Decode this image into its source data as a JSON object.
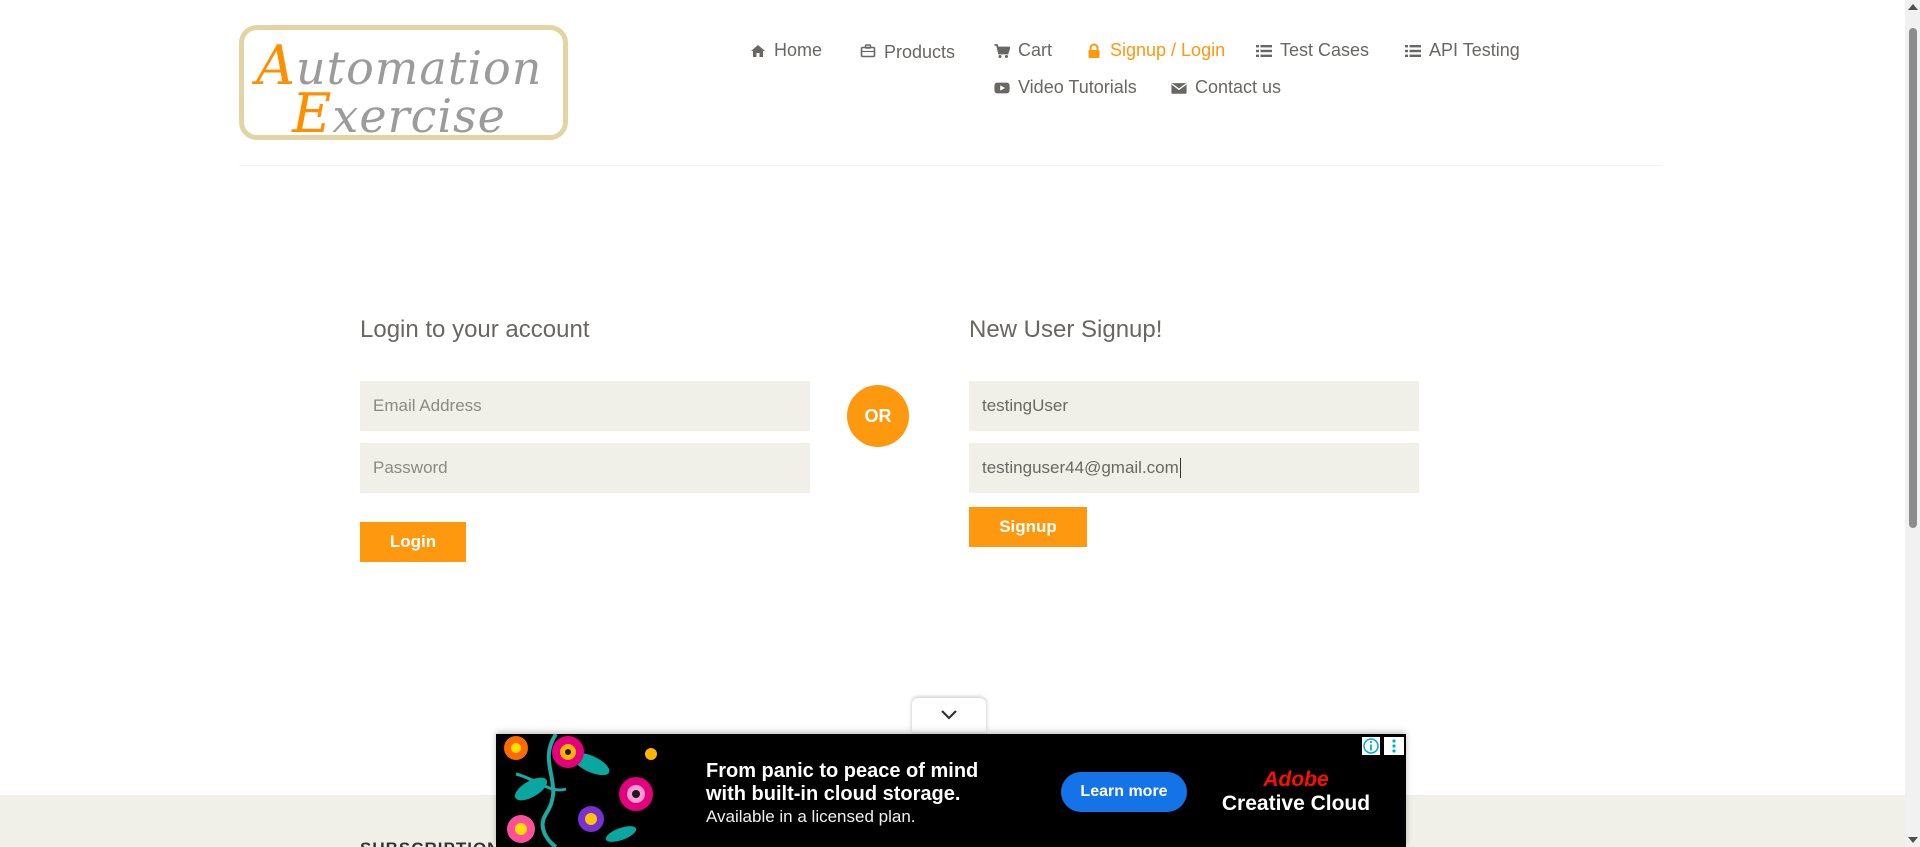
{
  "logo": {
    "line1_cap": "A",
    "line1_rest": "utomation",
    "line2_cap": "E",
    "line2_rest": "xercise"
  },
  "nav": {
    "items": [
      {
        "label": "Home",
        "icon": "home-icon"
      },
      {
        "label": "Products",
        "icon": "briefcase-icon"
      },
      {
        "label": "Cart",
        "icon": "cart-icon"
      },
      {
        "label": "Signup / Login",
        "icon": "lock-icon",
        "active": true
      },
      {
        "label": "Test Cases",
        "icon": "list-icon"
      },
      {
        "label": "API Testing",
        "icon": "list-icon"
      },
      {
        "label": "Video Tutorials",
        "icon": "youtube-icon"
      },
      {
        "label": "Contact us",
        "icon": "envelope-icon"
      }
    ]
  },
  "login": {
    "title": "Login to your account",
    "email_placeholder": "Email Address",
    "password_placeholder": "Password",
    "button": "Login"
  },
  "divider": {
    "or": "OR"
  },
  "signup": {
    "title": "New User Signup!",
    "name_value": "testingUser",
    "email_value": "testinguser44@gmail.com",
    "button": "Signup"
  },
  "footer": {
    "title": "SUBSCRIPTION"
  },
  "ad": {
    "headline_1": "From panic to peace of mind",
    "headline_2": "with built-in cloud storage.",
    "sub": "Available in a licensed plan.",
    "cta": "Learn more",
    "brand_top": "Adobe",
    "brand_bottom": "Creative Cloud"
  },
  "colors": {
    "accent": "#fe980f",
    "input_bg": "#f0f0e9",
    "text": "#696763",
    "ad_cta": "#1473e6"
  }
}
